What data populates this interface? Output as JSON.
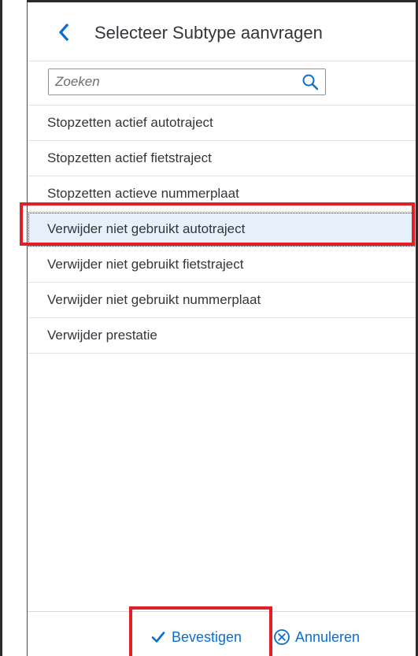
{
  "dialog": {
    "title": "Selecteer Subtype aanvragen",
    "back_icon": "chevron-left-icon"
  },
  "search": {
    "placeholder": "Zoeken",
    "value": "",
    "icon": "search-icon"
  },
  "list": {
    "items": [
      {
        "label": "Stopzetten actief autotraject",
        "selected": false
      },
      {
        "label": "Stopzetten actief fietstraject",
        "selected": false
      },
      {
        "label": "Stopzetten actieve nummerplaat",
        "selected": false
      },
      {
        "label": "Verwijder niet gebruikt autotraject",
        "selected": true
      },
      {
        "label": "Verwijder niet gebruikt fietstraject",
        "selected": false
      },
      {
        "label": "Verwijder niet gebruikt nummerplaat",
        "selected": false
      },
      {
        "label": "Verwijder prestatie",
        "selected": false
      }
    ]
  },
  "footer": {
    "confirm_label": "Bevestigen",
    "confirm_icon": "checkmark-icon",
    "cancel_label": "Annuleren",
    "cancel_icon": "circle-x-icon"
  },
  "colors": {
    "accent": "#0a6ed1",
    "text": "#32363a",
    "selected_bg": "#e5f0fa",
    "annotation_red": "#e31e24"
  }
}
